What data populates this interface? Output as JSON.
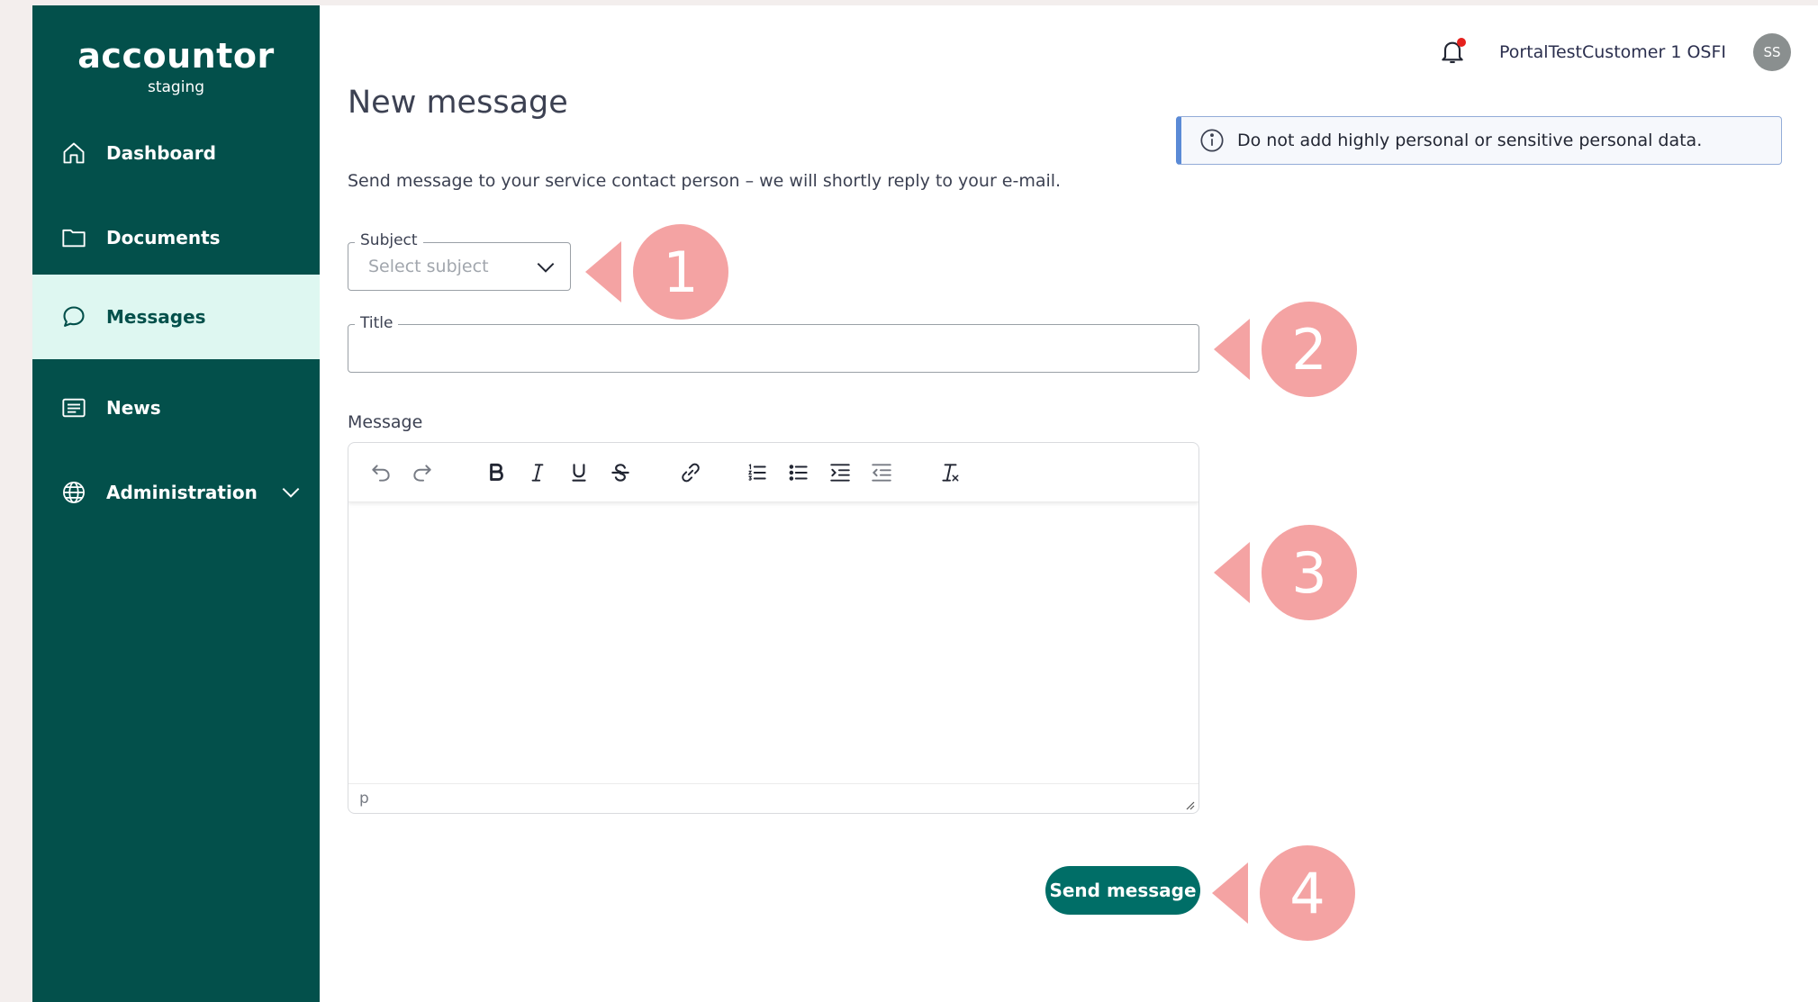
{
  "brand": {
    "name": "accountor",
    "env": "staging"
  },
  "sidebar": {
    "items": [
      {
        "label": "Dashboard",
        "icon": "home-icon"
      },
      {
        "label": "Documents",
        "icon": "folder-icon"
      },
      {
        "label": "Messages",
        "icon": "chat-bubble-icon",
        "active": true
      },
      {
        "label": "News",
        "icon": "newspaper-icon"
      },
      {
        "label": "Administration",
        "icon": "globe-icon",
        "expandable": true
      }
    ]
  },
  "header": {
    "user_name": "PortalTestCustomer 1 OSFI",
    "avatar_initials": "SS",
    "notification_dot": true
  },
  "page": {
    "title": "New message",
    "intro": "Send message to your service contact person – we will shortly reply to your e-mail.",
    "notice": "Do not add highly personal or sensitive personal data."
  },
  "form": {
    "subject_label": "Subject",
    "subject_placeholder": "Select subject",
    "title_label": "Title",
    "title_value": "",
    "message_label": "Message",
    "editor_status": "p",
    "send_label": "Send message"
  },
  "toolbar": [
    "undo-icon",
    "redo-icon",
    "bold-icon",
    "italic-icon",
    "underline-icon",
    "strikethrough-icon",
    "link-icon",
    "numbered-list-icon",
    "bullet-list-icon",
    "indent-icon",
    "outdent-icon",
    "clear-format-icon"
  ],
  "callouts": [
    "1",
    "2",
    "3",
    "4"
  ],
  "colors": {
    "sidebar": "#03504b",
    "active_bg": "#def7f1",
    "accent": "#006e67",
    "callout": "#f4a3a3"
  }
}
